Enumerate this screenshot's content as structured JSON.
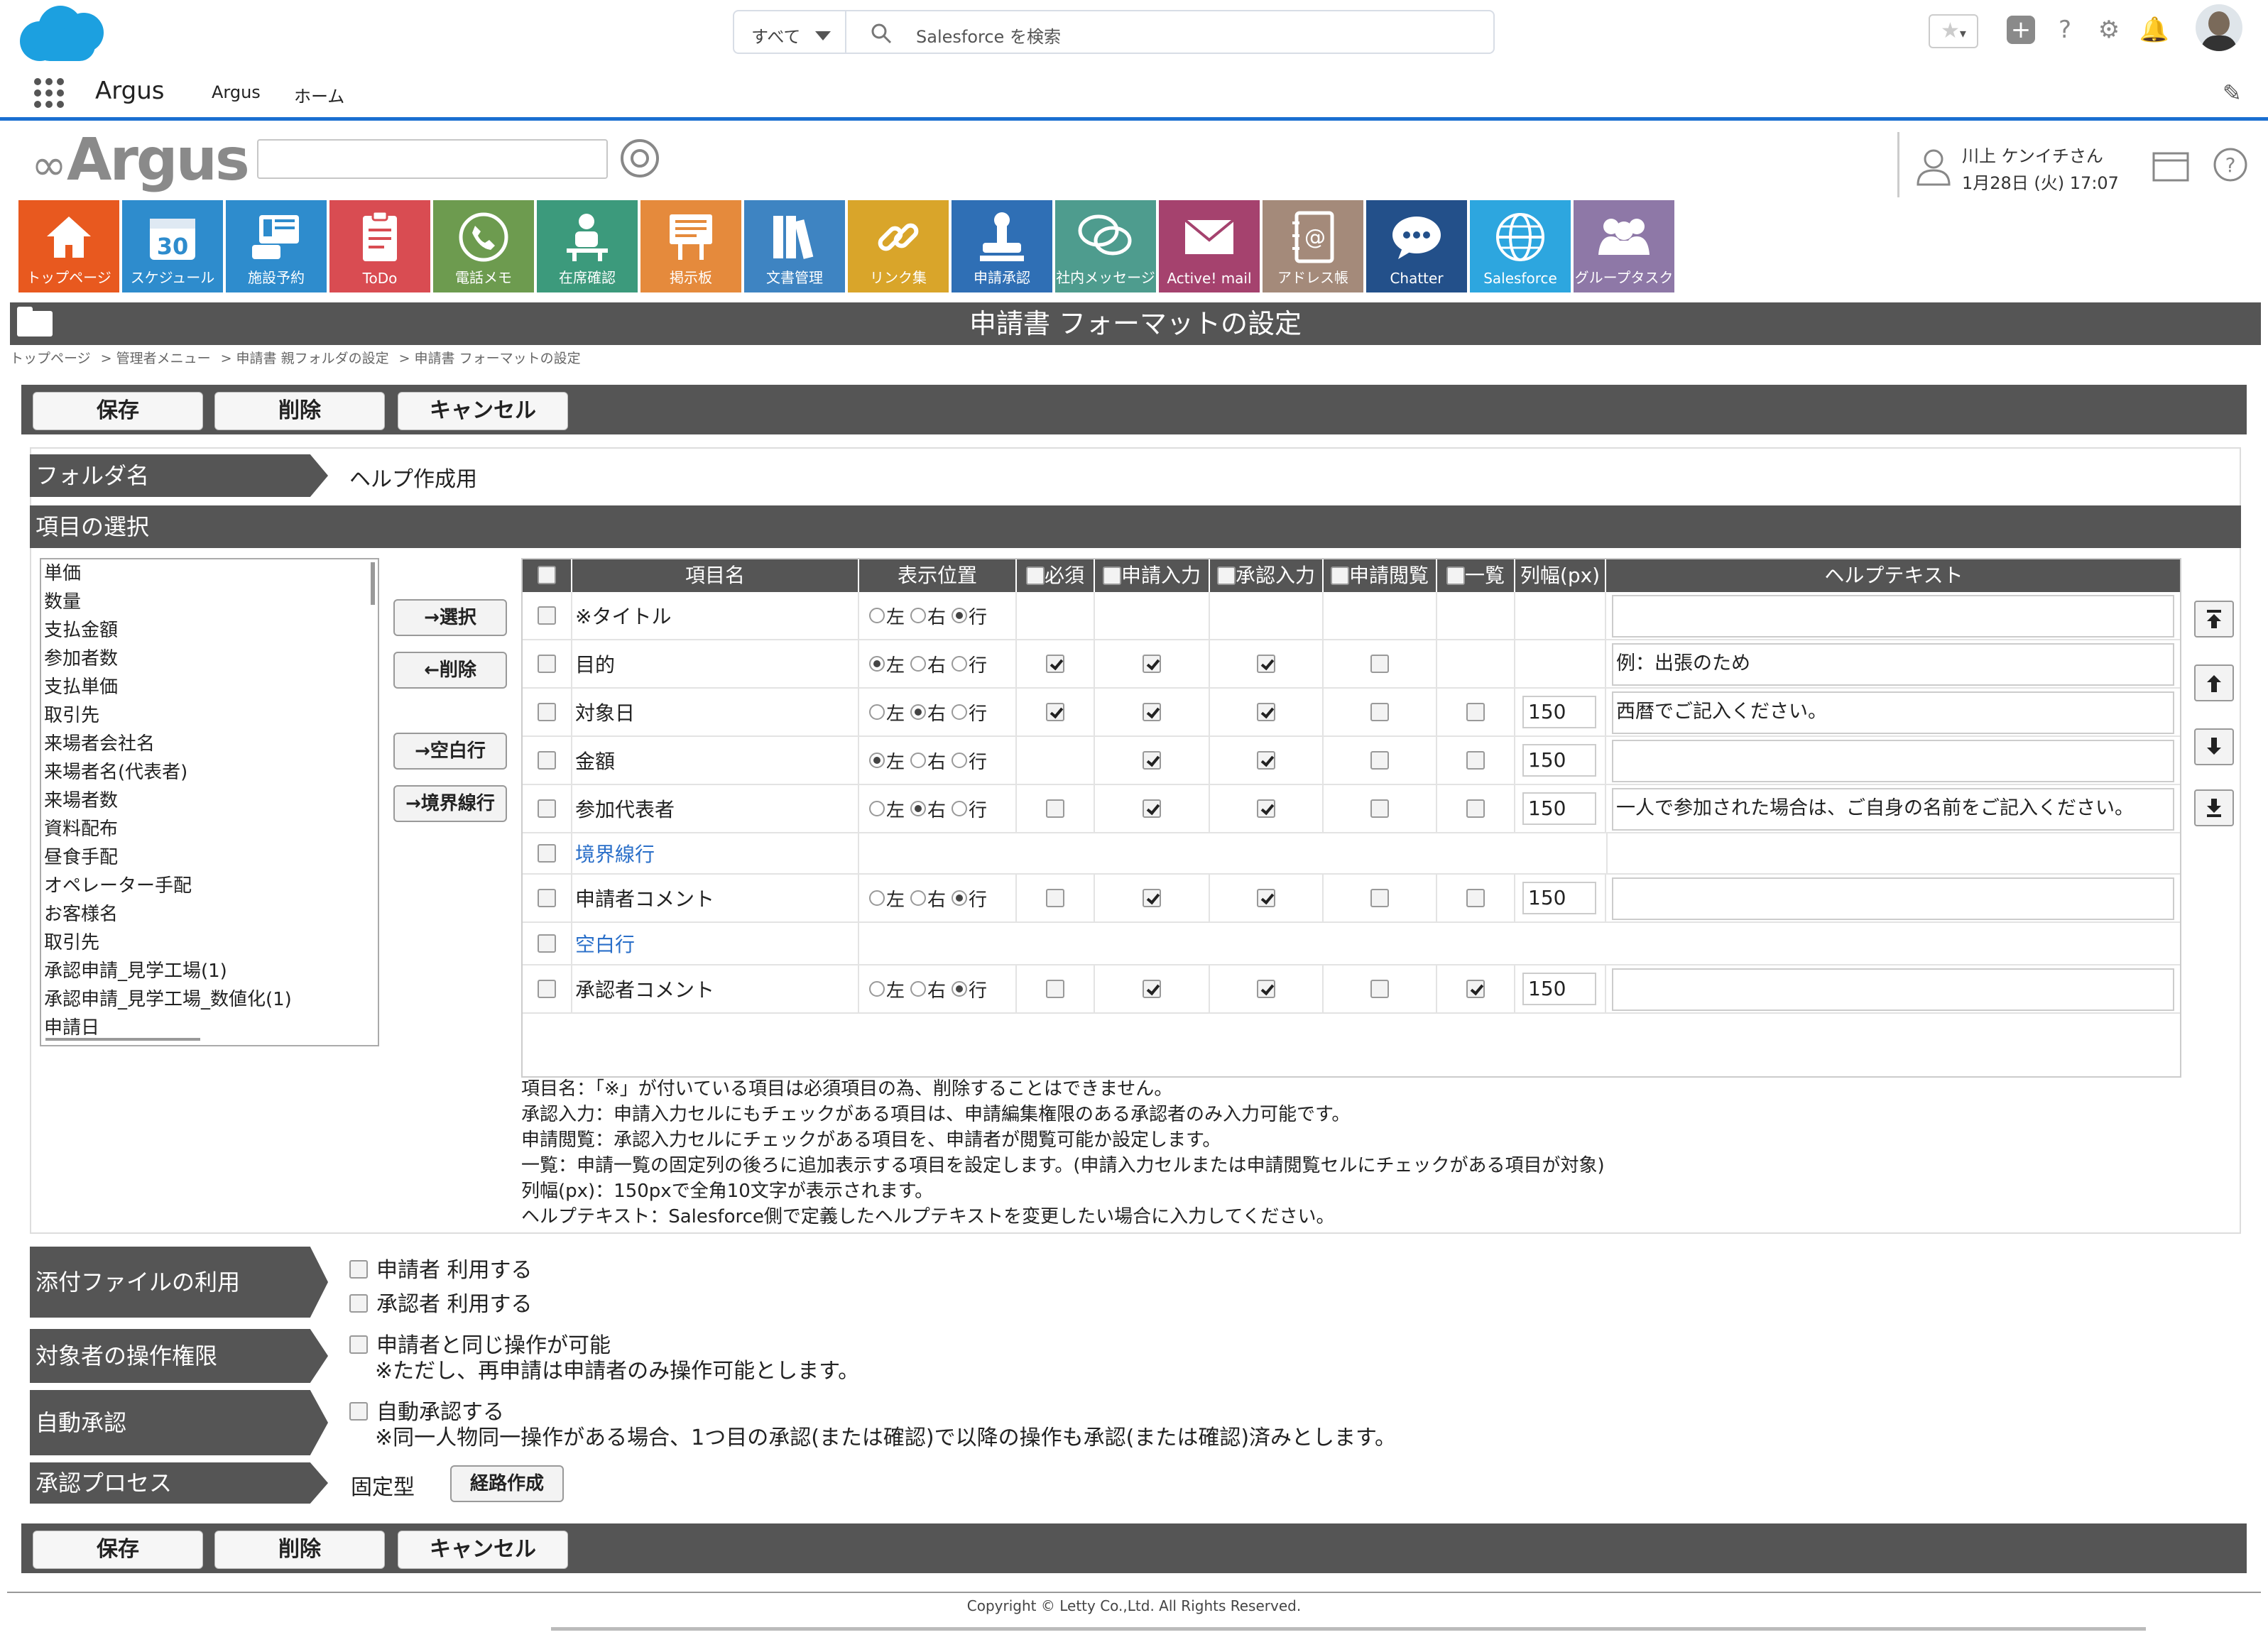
{
  "salesforce_bar": {
    "search_scope": "すべて",
    "search_placeholder": "Salesforce を検索",
    "app_name": "Argus",
    "nav_items": [
      "Argus",
      "ホーム"
    ],
    "icons": [
      "favorite-star-icon",
      "add-icon",
      "help-icon",
      "setup-gear-icon",
      "bell-icon",
      "avatar"
    ]
  },
  "argus_header": {
    "logo_text": "Argus",
    "search_value": "",
    "user_name": "川上 ケンイチさん",
    "datetime": "1月28日 (火) 17:07"
  },
  "tiles": [
    {
      "label": "トップページ",
      "color": "#e8591f",
      "icon": "home-icon"
    },
    {
      "label": "スケジュール",
      "color": "#2e8ccd",
      "icon": "calendar-icon",
      "number": "30"
    },
    {
      "label": "施設予約",
      "color": "#2e8ccd",
      "icon": "facility-icon"
    },
    {
      "label": "ToDo",
      "color": "#d94c52",
      "icon": "todo-icon"
    },
    {
      "label": "電話メモ",
      "color": "#6d9b4f",
      "icon": "phone-icon"
    },
    {
      "label": "在席確認",
      "color": "#3c9a7c",
      "icon": "presence-icon"
    },
    {
      "label": "掲示板",
      "color": "#e58a3c",
      "icon": "board-icon"
    },
    {
      "label": "文書管理",
      "color": "#3e84c2",
      "icon": "documents-icon"
    },
    {
      "label": "リンク集",
      "color": "#d9a52a",
      "icon": "link-icon"
    },
    {
      "label": "申請承認",
      "color": "#2f6fb5",
      "icon": "stamp-icon"
    },
    {
      "label": "社内メッセージ",
      "color": "#4e9c8e",
      "icon": "message-icon"
    },
    {
      "label": "Active! mail",
      "color": "#a5426e",
      "icon": "mail-icon"
    },
    {
      "label": "アドレス帳",
      "color": "#a48a7a",
      "icon": "address-book-icon"
    },
    {
      "label": "Chatter",
      "color": "#23508a",
      "icon": "chatter-icon"
    },
    {
      "label": "Salesforce",
      "color": "#2da6df",
      "icon": "globe-icon"
    },
    {
      "label": "グループタスク",
      "color": "#8e78a7",
      "icon": "group-icon"
    }
  ],
  "page_title": "申請書 フォーマットの設定",
  "breadcrumb": [
    "トップページ",
    "> 管理者メニュー",
    "> 申請書 親フォルダの設定",
    "> 申請書 フォーマットの設定"
  ],
  "buttons": {
    "save": "保存",
    "delete": "削除",
    "cancel": "キャンセル"
  },
  "folder": {
    "label": "フォルダ名",
    "value": "ヘルプ作成用"
  },
  "selection": {
    "label": "項目の選択",
    "list": [
      "単価",
      "数量",
      "支払金額",
      "参加者数",
      "支払単価",
      "取引先",
      "来場者会社名",
      "来場者名(代表者)",
      "来場者数",
      "資料配布",
      "昼食手配",
      "オペレーター手配",
      "お客様名",
      "取引先",
      "承認申請_見学工場(1)",
      "承認申請_見学工場_数値化(1)",
      "申請日"
    ],
    "btn_select": "→選択",
    "btn_remove": "←削除",
    "btn_blank": "→空白行",
    "btn_border": "→境界線行"
  },
  "grid": {
    "headers": {
      "name": "項目名",
      "position": "表示位置",
      "required": "必須",
      "input": "申請入力",
      "approval": "承認入力",
      "view": "申請閲覧",
      "list": "一覧",
      "width": "列幅(px)",
      "help": "ヘルプテキスト"
    },
    "pos_labels": [
      "左",
      "右",
      "行"
    ],
    "rows": [
      {
        "name": "※タイトル",
        "type": "field",
        "pos": 2,
        "required": false,
        "input": false,
        "approval": false,
        "view": false,
        "list": false,
        "show_flags": false,
        "width": "",
        "help": ""
      },
      {
        "name": "目的",
        "type": "field",
        "pos": 0,
        "required": true,
        "input": true,
        "approval": true,
        "view": false,
        "list": false,
        "show_list": false,
        "width": "",
        "help": "例：出張のため"
      },
      {
        "name": "対象日",
        "type": "field",
        "pos": 1,
        "required": true,
        "input": true,
        "approval": true,
        "view": false,
        "list": false,
        "width": "150",
        "help": "西暦でご記入ください。"
      },
      {
        "name": "金額",
        "type": "field",
        "pos": 0,
        "required": false,
        "no_required": true,
        "input": true,
        "approval": true,
        "view": false,
        "list": false,
        "width": "150",
        "help": ""
      },
      {
        "name": "参加代表者",
        "type": "field",
        "pos": 1,
        "required": false,
        "input": true,
        "approval": true,
        "view": false,
        "list": false,
        "width": "150",
        "help": "一人で参加された場合は、ご自身の名前をご記入ください。"
      },
      {
        "name": "境界線行",
        "type": "border"
      },
      {
        "name": "申請者コメント",
        "type": "field",
        "pos": 2,
        "required": false,
        "input": true,
        "approval": true,
        "view": false,
        "list": false,
        "width": "150",
        "help": ""
      },
      {
        "name": "空白行",
        "type": "blank"
      },
      {
        "name": "承認者コメント",
        "type": "field",
        "pos": 2,
        "required": false,
        "input": true,
        "approval": true,
        "view": false,
        "list": true,
        "width": "150",
        "help": ""
      }
    ]
  },
  "notes": [
    "項目名：「※」が付いている項目は必須項目の為、削除することはできません。",
    "承認入力：申請入力セルにもチェックがある項目は、申請編集権限のある承認者のみ入力可能です。",
    "申請閲覧：承認入力セルにチェックがある項目を、申請者が閲覧可能か設定します。",
    "一覧：申請一覧の固定列の後ろに追加表示する項目を設定します。(申請入力セルまたは申請閲覧セルにチェックがある項目が対象)",
    "列幅(px)：150pxで全角10文字が表示されます。",
    "ヘルプテキスト：Salesforce側で定義したヘルプテキストを変更したい場合に入力してください。"
  ],
  "attachments": {
    "label": "添付ファイルの利用",
    "applicant": "申請者 利用する",
    "approver": "承認者 利用する"
  },
  "permission": {
    "label": "対象者の操作権限",
    "option": "申請者と同じ操作が可能",
    "note": "※ただし、再申請は申請者のみ操作可能とします。"
  },
  "auto_approval": {
    "label": "自動承認",
    "option": "自動承認する",
    "note": "※同一人物同一操作がある場合、1つ目の承認(または確認)で以降の操作も承認(または確認)済みとします。"
  },
  "process": {
    "label": "承認プロセス",
    "value": "固定型",
    "button": "経路作成"
  },
  "copyright": "Copyright © Letty Co.,Ltd. All Rights Reserved."
}
